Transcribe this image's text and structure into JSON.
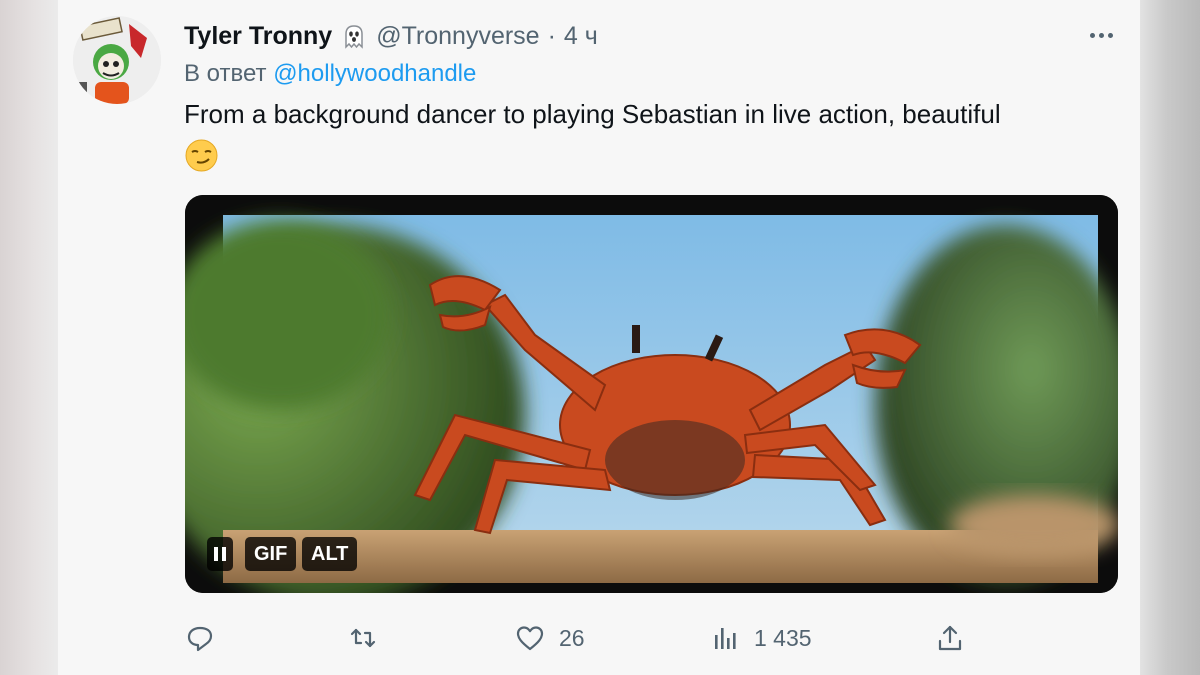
{
  "tweet": {
    "display_name": "Tyler Tronny",
    "name_icon": "ghost-icon",
    "handle": "@Tronnyverse",
    "separator": "·",
    "time": "4 ч",
    "reply_prefix": "В ответ",
    "reply_mention": "@hollywoodhandle",
    "text": "From a background dancer to playing Sebastian in live action, beautiful",
    "emoji": "smirk-emoji"
  },
  "media": {
    "type": "gif",
    "subject": "red crab dancing on a beach",
    "badges": {
      "pause_icon": "pause-icon",
      "gif_label": "GIF",
      "alt_label": "ALT"
    }
  },
  "actions": {
    "reply": {
      "icon": "reply-icon",
      "count": ""
    },
    "retweet": {
      "icon": "retweet-icon",
      "count": ""
    },
    "like": {
      "icon": "heart-icon",
      "count": "26"
    },
    "views": {
      "icon": "views-icon",
      "count": "1 435"
    },
    "share": {
      "icon": "share-icon",
      "count": ""
    }
  },
  "colors": {
    "link": "#1d9bf0",
    "text": "#0f1419",
    "secondary": "#536471",
    "card_bg": "#f7f7f7"
  }
}
